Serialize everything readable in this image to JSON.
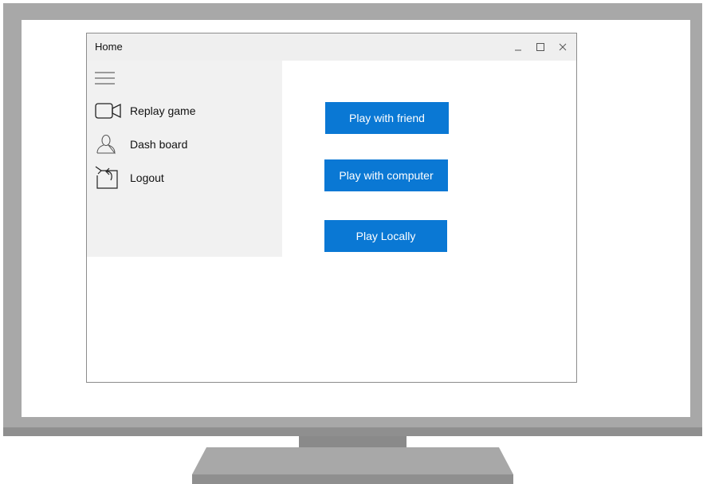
{
  "window": {
    "title": "Home",
    "controls": [
      "minimize-icon",
      "maximize-icon",
      "close-icon"
    ]
  },
  "sidebar": {
    "menu_icon": "hamburger-menu-icon",
    "items": [
      {
        "label": "Replay game",
        "icon": "video-camera-icon"
      },
      {
        "label": "Dash board",
        "icon": "user-icon"
      },
      {
        "label": "Logout",
        "icon": "logout-icon"
      }
    ]
  },
  "main": {
    "buttons": [
      {
        "label": "Play with friend"
      },
      {
        "label": "Play with computer"
      },
      {
        "label": "Play Locally"
      }
    ]
  },
  "colors": {
    "accent": "#0a78d4",
    "sidebar_bg": "#f1f1f1",
    "titlebar_bg": "#efefef",
    "monitor": "#a8a8a8"
  }
}
